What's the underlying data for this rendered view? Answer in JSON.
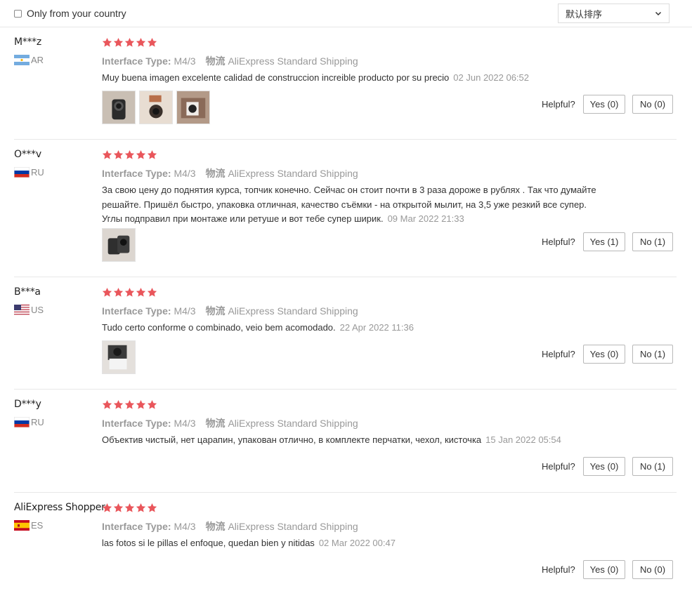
{
  "filter": {
    "only_country_label": "Only from your country"
  },
  "sort": {
    "selected": "默认排序"
  },
  "labels": {
    "interface_type": "Interface Type:",
    "shipping_label": "物流",
    "helpful": "Helpful?"
  },
  "colors": {
    "star": "#e9565b",
    "meta_gray": "#999999",
    "divider": "#e8e8e8"
  },
  "reviews": [
    {
      "name": "M***z",
      "country": "AR",
      "flag": "argentina-flag-icon",
      "stars": 5,
      "interface_value": "M4/3",
      "shipping_value": "AliExpress Standard Shipping",
      "text": "Muy buena imagen excelente calidad de construccion increible producto por su precio",
      "date": "02 Jun 2022 06:52",
      "photos": [
        "review-photo-lens-1",
        "review-photo-lens-2",
        "review-photo-lens-3"
      ],
      "yes": "Yes (0)",
      "no": "No (0)"
    },
    {
      "name": "O***v",
      "country": "RU",
      "flag": "russia-flag-icon",
      "stars": 5,
      "interface_value": "M4/3",
      "shipping_value": "AliExpress Standard Shipping",
      "text": "За свою цену до поднятия курса, топчик конечно. Сейчас он стоит почти в 3 раза дороже в рублях . Так что думайте решайте. Пришёл быстро, упаковка отличная, качество съёмки - на открытой мылит, на 3,5 уже резкий все супер. Углы подправил при монтаже или ретуше и вот тебе супер ширик.",
      "date": "09 Mar 2022 21:33",
      "photos": [
        "review-photo-lens-4"
      ],
      "yes": "Yes (1)",
      "no": "No (1)"
    },
    {
      "name": "B***a",
      "country": "US",
      "flag": "usa-flag-icon",
      "stars": 5,
      "interface_value": "M4/3",
      "shipping_value": "AliExpress Standard Shipping",
      "text": "Tudo certo conforme o combinado, veio bem acomodado.",
      "date": "22 Apr 2022 11:36",
      "photos": [
        "review-photo-lens-5"
      ],
      "yes": "Yes (0)",
      "no": "No (1)"
    },
    {
      "name": "D***y",
      "country": "RU",
      "flag": "russia-flag-icon",
      "stars": 5,
      "interface_value": "M4/3",
      "shipping_value": "AliExpress Standard Shipping",
      "text": "Объектив чистый, нет царапин, упакован отлично, в комплекте перчатки, чехол, кисточка",
      "date": "15 Jan 2022 05:54",
      "photos": [],
      "yes": "Yes (0)",
      "no": "No (1)"
    },
    {
      "name": "AliExpress Shopper",
      "country": "ES",
      "flag": "spain-flag-icon",
      "stars": 5,
      "interface_value": "M4/3",
      "shipping_value": "AliExpress Standard Shipping",
      "text": "las fotos si le pillas el enfoque, quedan bien y nitidas",
      "date": "02 Mar 2022 00:47",
      "photos": [],
      "yes": "Yes (0)",
      "no": "No (0)"
    }
  ]
}
